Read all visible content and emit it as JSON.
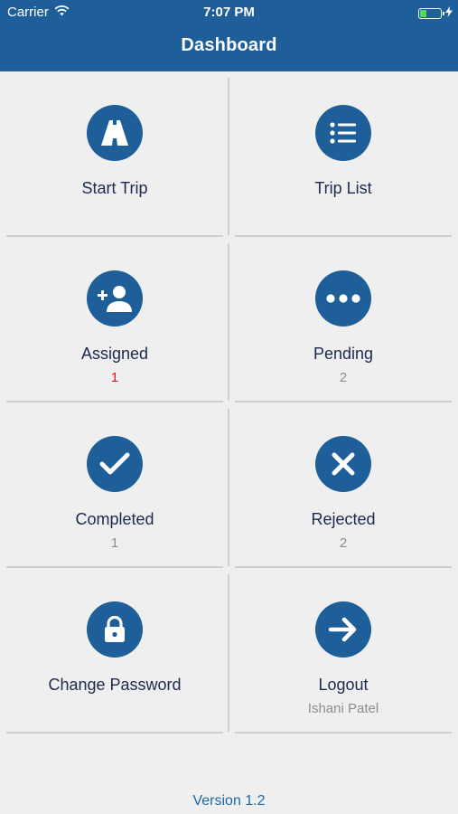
{
  "status_bar": {
    "carrier": "Carrier",
    "time": "7:07 PM"
  },
  "header": {
    "title": "Dashboard"
  },
  "tiles": [
    {
      "label": "Start Trip",
      "count": "",
      "icon": "road-icon"
    },
    {
      "label": "Trip List",
      "count": "",
      "icon": "list-icon"
    },
    {
      "label": "Assigned",
      "count": "1",
      "icon": "add-user-icon"
    },
    {
      "label": "Pending",
      "count": "2",
      "icon": "more-dots-icon"
    },
    {
      "label": "Completed",
      "count": "1",
      "icon": "checkmark-icon"
    },
    {
      "label": "Rejected",
      "count": "2",
      "icon": "close-icon"
    },
    {
      "label": "Change Password",
      "count": "",
      "icon": "lock-icon"
    },
    {
      "label": "Logout",
      "count": "Ishani Patel",
      "icon": "arrow-right-icon"
    }
  ],
  "footer": {
    "version": "Version 1.2"
  },
  "colors": {
    "brand": "#1e5f99",
    "assigned_count": "#e0191e",
    "muted": "#8d8d8d",
    "label": "#1c2a4f"
  }
}
